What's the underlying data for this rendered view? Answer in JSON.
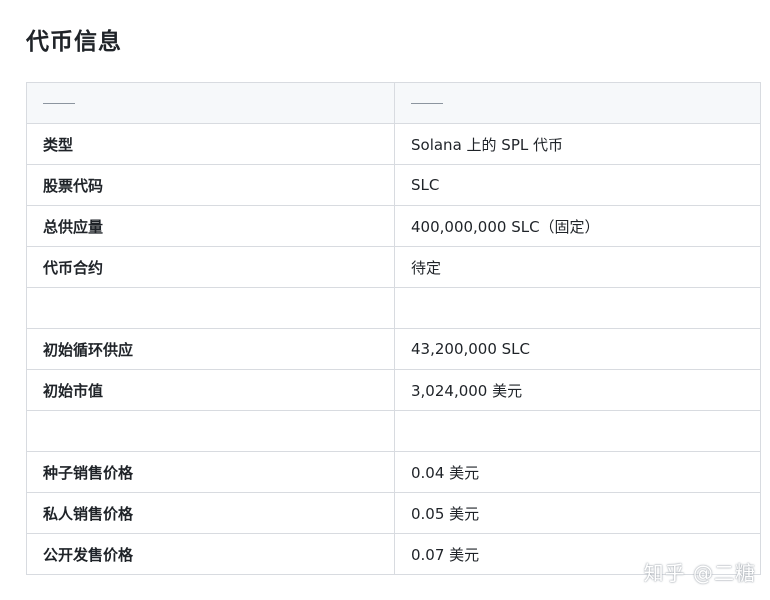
{
  "title": "代币信息",
  "table": {
    "header": [
      "——",
      "——"
    ],
    "rows": [
      {
        "key": "类型",
        "value": "Solana 上的 SPL 代币"
      },
      {
        "key": "股票代码",
        "value": "SLC"
      },
      {
        "key": "总供应量",
        "value": "400,000,000 SLC（固定）"
      },
      {
        "key": "代币合约",
        "value": "待定"
      },
      {
        "key": "",
        "value": ""
      },
      {
        "key": "初始循环供应",
        "value": "43,200,000 SLC"
      },
      {
        "key": "初始市值",
        "value": "3,024,000 美元"
      },
      {
        "key": "",
        "value": ""
      },
      {
        "key": "种子销售价格",
        "value": "0.04 美元"
      },
      {
        "key": "私人销售价格",
        "value": "0.05 美元"
      },
      {
        "key": "公开发售价格",
        "value": "0.07 美元"
      }
    ]
  },
  "watermark": "知乎 @二糖",
  "colors": {
    "border": "#d8dbe0",
    "header_bg": "#f6f8fa",
    "text": "#1f2328"
  }
}
